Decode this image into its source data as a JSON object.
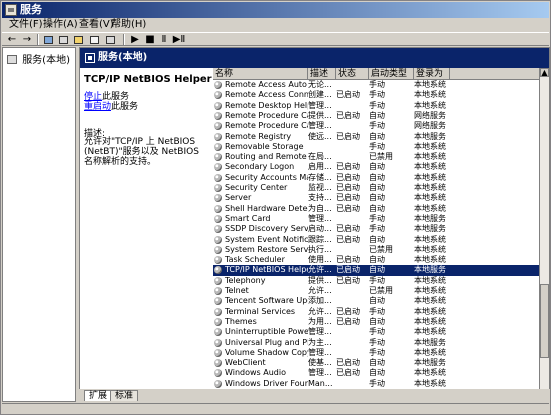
{
  "window": {
    "title": "服务"
  },
  "menu": {
    "items": [
      "文件(F)",
      "操作(A)",
      "查看(V)",
      "帮助(H)"
    ]
  },
  "toolbar": {
    "icons": [
      "back-icon",
      "forward-icon",
      "console-icon",
      "properties-icon",
      "refresh-icon",
      "export-icon",
      "help-icon",
      "play-icon",
      "stop-icon",
      "pause-icon",
      "restart-icon"
    ]
  },
  "tree": {
    "root_label": "服务(本地)"
  },
  "pane": {
    "header_title": "服务(本地)",
    "selected_service": "TCP/IP NetBIOS Helper",
    "action_stop": "停止",
    "action_stop_suffix": "此服务",
    "action_restart": "重启动",
    "action_restart_suffix": "此服务",
    "description_label": "描述:",
    "description_text": "允许对\"TCP/IP 上 NetBIOS (NetBT)\"服务以及 NetBIOS 名称解析的支持。"
  },
  "table": {
    "headers": [
      "名称",
      "描述",
      "状态",
      "启动类型",
      "登录为"
    ],
    "rows": [
      {
        "name": "Remote Access Auto Conne...",
        "desc": "无论...",
        "status": "",
        "startup": "手动",
        "logon": "本地系统"
      },
      {
        "name": "Remote Access Connecti...",
        "desc": "创建...",
        "status": "已启动",
        "startup": "手动",
        "logon": "本地系统"
      },
      {
        "name": "Remote Desktop Help Se...",
        "desc": "管理...",
        "status": "",
        "startup": "手动",
        "logon": "本地系统"
      },
      {
        "name": "Remote Procedure Call (...",
        "desc": "提供...",
        "status": "已启动",
        "startup": "自动",
        "logon": "网络服务"
      },
      {
        "name": "Remote Procedure Call (...",
        "desc": "管理...",
        "status": "",
        "startup": "手动",
        "logon": "网络服务"
      },
      {
        "name": "Remote Registry",
        "desc": "使远...",
        "status": "已启动",
        "startup": "自动",
        "logon": "本地服务"
      },
      {
        "name": "Removable Storage",
        "desc": "",
        "status": "",
        "startup": "手动",
        "logon": "本地系统"
      },
      {
        "name": "Routing and Remote Acc...",
        "desc": "在局...",
        "status": "",
        "startup": "已禁用",
        "logon": "本地系统"
      },
      {
        "name": "Secondary Logon",
        "desc": "启用...",
        "status": "已启动",
        "startup": "自动",
        "logon": "本地系统"
      },
      {
        "name": "Security Accounts Manager",
        "desc": "存储...",
        "status": "已启动",
        "startup": "自动",
        "logon": "本地系统"
      },
      {
        "name": "Security Center",
        "desc": "监视...",
        "status": "已启动",
        "startup": "自动",
        "logon": "本地系统"
      },
      {
        "name": "Server",
        "desc": "支持...",
        "status": "已启动",
        "startup": "自动",
        "logon": "本地系统"
      },
      {
        "name": "Shell Hardware Detection",
        "desc": "为自...",
        "status": "已启动",
        "startup": "自动",
        "logon": "本地系统"
      },
      {
        "name": "Smart Card",
        "desc": "管理...",
        "status": "",
        "startup": "手动",
        "logon": "本地服务"
      },
      {
        "name": "SSDP Discovery Service",
        "desc": "启动...",
        "status": "已启动",
        "startup": "手动",
        "logon": "本地服务"
      },
      {
        "name": "System Event Notification",
        "desc": "跟踪...",
        "status": "已启动",
        "startup": "自动",
        "logon": "本地系统"
      },
      {
        "name": "System Restore Service",
        "desc": "执行...",
        "status": "",
        "startup": "已禁用",
        "logon": "本地系统"
      },
      {
        "name": "Task Scheduler",
        "desc": "使用...",
        "status": "已启动",
        "startup": "自动",
        "logon": "本地系统"
      },
      {
        "name": "TCP/IP NetBIOS Helper",
        "desc": "允许...",
        "status": "已启动",
        "startup": "自动",
        "logon": "本地服务"
      },
      {
        "name": "Telephony",
        "desc": "提供...",
        "status": "已启动",
        "startup": "手动",
        "logon": "本地系统"
      },
      {
        "name": "Telnet",
        "desc": "允许...",
        "status": "",
        "startup": "已禁用",
        "logon": "本地系统"
      },
      {
        "name": "Tencent Software Updat...",
        "desc": "添加...",
        "status": "",
        "startup": "自动",
        "logon": "本地系统"
      },
      {
        "name": "Terminal Services",
        "desc": "允许...",
        "status": "已启动",
        "startup": "手动",
        "logon": "本地系统"
      },
      {
        "name": "Themes",
        "desc": "为用...",
        "status": "已启动",
        "startup": "自动",
        "logon": "本地系统"
      },
      {
        "name": "Uninterruptible Power Su...",
        "desc": "管理...",
        "status": "",
        "startup": "手动",
        "logon": "本地系统"
      },
      {
        "name": "Universal Plug and Play D...",
        "desc": "为主...",
        "status": "",
        "startup": "手动",
        "logon": "本地服务"
      },
      {
        "name": "Volume Shadow Copy",
        "desc": "管理...",
        "status": "",
        "startup": "手动",
        "logon": "本地系统"
      },
      {
        "name": "WebClient",
        "desc": "使基...",
        "status": "已启动",
        "startup": "自动",
        "logon": "本地服务"
      },
      {
        "name": "Windows Audio",
        "desc": "管理...",
        "status": "已启动",
        "startup": "自动",
        "logon": "本地系统"
      },
      {
        "name": "Windows Driver Foundati...",
        "desc": "Man...",
        "status": "",
        "startup": "手动",
        "logon": "本地系统"
      }
    ]
  },
  "tabs": {
    "items": [
      "扩展",
      "标准"
    ]
  }
}
